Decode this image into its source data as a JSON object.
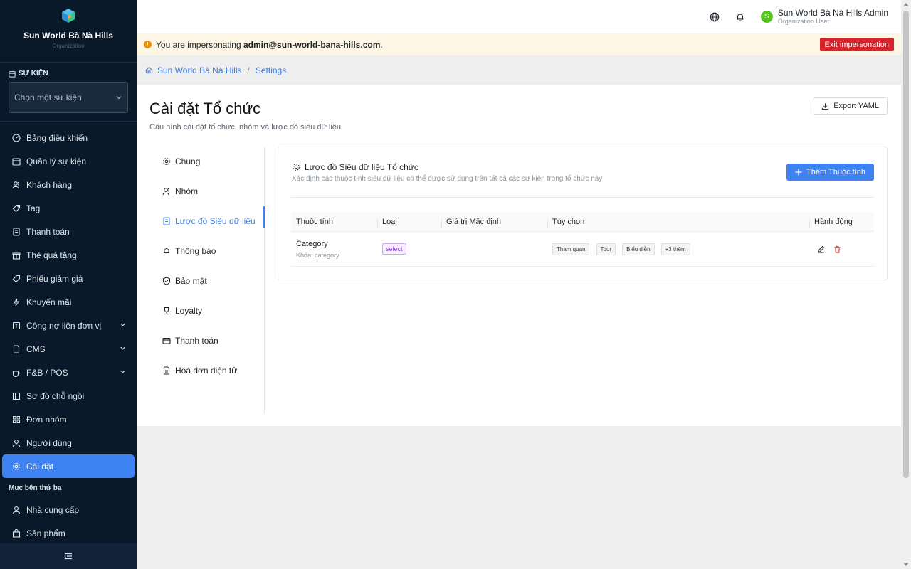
{
  "brand": {
    "name": "Sun World Bà Nà Hills",
    "sub": "Organization"
  },
  "event": {
    "section_label": "SỰ KIỆN",
    "select_placeholder": "Chọn một sự kiện"
  },
  "nav": {
    "items": [
      {
        "label": "Bảng điều khiển"
      },
      {
        "label": "Quản lý sự kiện"
      },
      {
        "label": "Khách hàng"
      },
      {
        "label": "Tag"
      },
      {
        "label": "Thanh toán"
      },
      {
        "label": "Thẻ quà tặng"
      },
      {
        "label": "Phiếu giảm giá"
      },
      {
        "label": "Khuyến mãi"
      },
      {
        "label": "Công nợ liên đơn vị"
      },
      {
        "label": "CMS"
      },
      {
        "label": "F&B / POS"
      },
      {
        "label": "Sơ đồ chỗ ngồi"
      },
      {
        "label": "Đơn nhóm"
      },
      {
        "label": "Người dùng"
      },
      {
        "label": "Cài đặt"
      }
    ],
    "third_party_title": "Mục bên thứ ba",
    "third_party": [
      {
        "label": "Nhà cung cấp"
      },
      {
        "label": "Sản phẩm"
      }
    ]
  },
  "user": {
    "initial": "S",
    "name": "Sun World Bà Nà Hills Admin",
    "role": "Organization User"
  },
  "banner": {
    "prefix": "You are impersonating ",
    "email": "admin@sun-world-bana-hills.com",
    "suffix": ".",
    "exit_label": "Exit impersonation"
  },
  "breadcrumb": {
    "home": "Sun World Bà Nà Hills",
    "separator": "/",
    "current": "Settings"
  },
  "page": {
    "title": "Cài đặt Tổ chức",
    "subtitle": "Cấu hình cài đặt tổ chức, nhóm và lược đồ siêu dữ liệu",
    "export_label": "Export YAML"
  },
  "settings_nav": [
    {
      "label": "Chung"
    },
    {
      "label": "Nhóm"
    },
    {
      "label": "Lược đồ Siêu dữ liệu"
    },
    {
      "label": "Thông báo"
    },
    {
      "label": "Bảo mật"
    },
    {
      "label": "Loyalty"
    },
    {
      "label": "Thanh toán"
    },
    {
      "label": "Hoá đơn điện tử"
    }
  ],
  "card": {
    "title": "Lược đồ Siêu dữ liệu Tổ chức",
    "subtitle": "Xác định các thuộc tính siêu dữ liệu có thể được sử dụng trên tất cả các sự kiện trong tổ chức này",
    "add_label": "Thêm Thuộc tính",
    "columns": [
      "Thuộc tính",
      "Loại",
      "Giá trị Mặc định",
      "Tùy chọn",
      "Hành động"
    ],
    "rows": [
      {
        "name": "Category",
        "key": "Khóa: category",
        "type": "select",
        "default": "",
        "options": [
          "Tham quan",
          "Tour",
          "Biểu diễn"
        ],
        "more": "+3 thêm"
      }
    ]
  },
  "colors": {
    "sidebar": "#0a1929",
    "accent": "#3f83f2",
    "danger": "#d9222a",
    "banner": "#fdf6e4"
  }
}
